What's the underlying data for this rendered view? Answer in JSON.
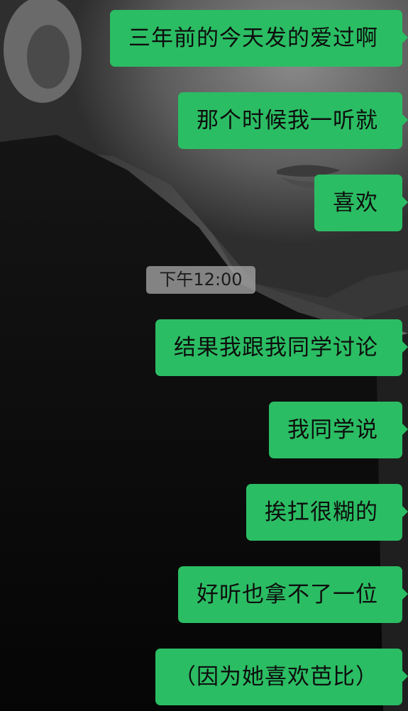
{
  "chat": {
    "messages_before": [
      {
        "text": "三年前的今天发的爱过啊"
      },
      {
        "text": "那个时候我一听就"
      },
      {
        "text": "喜欢"
      }
    ],
    "timestamp": "下午12:00",
    "messages_after": [
      {
        "text": "结果我跟我同学讨论"
      },
      {
        "text": "我同学说"
      },
      {
        "text": "挨扛很糊的"
      },
      {
        "text": "好听也拿不了一位"
      },
      {
        "text": "（因为她喜欢芭比）"
      }
    ],
    "colors": {
      "bubble": "#2bbd63",
      "timestamp_bg": "#aaaaaa"
    }
  }
}
